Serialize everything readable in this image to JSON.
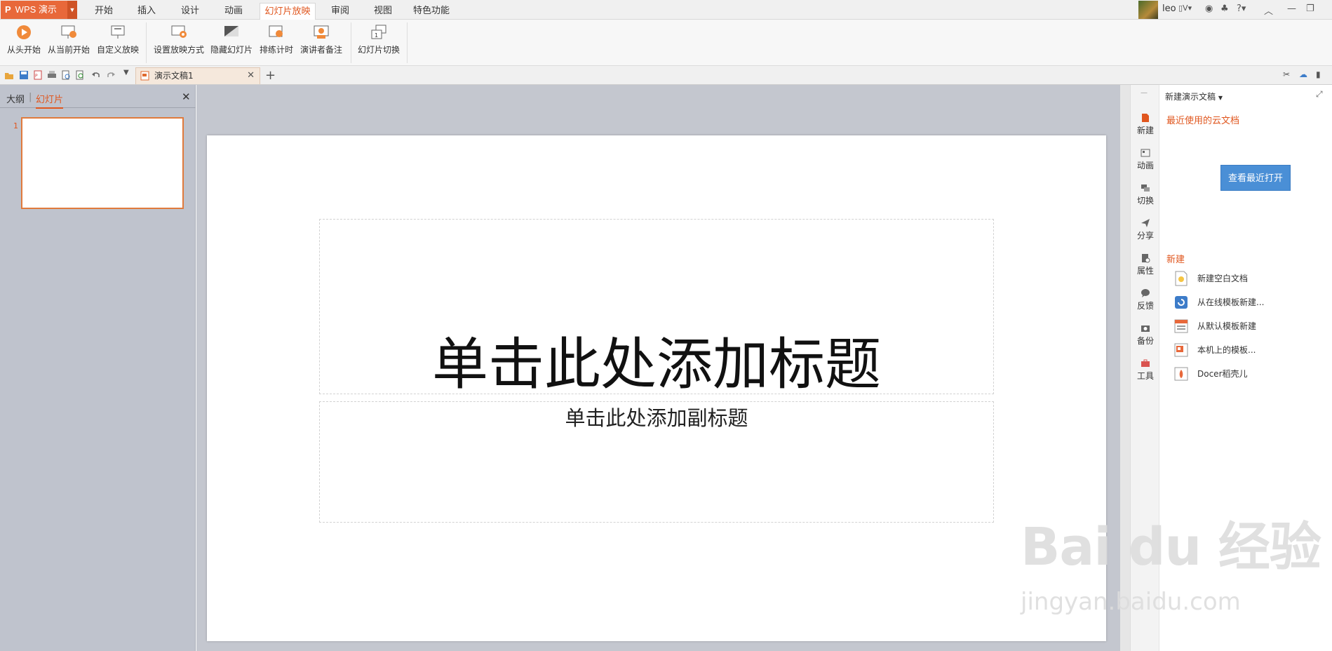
{
  "app": {
    "logo_text": "WPS 演示",
    "logo_glyph": "P"
  },
  "menu": {
    "tabs": [
      "开始",
      "插入",
      "设计",
      "动画",
      "幻灯片放映",
      "审阅",
      "视图",
      "特色功能"
    ],
    "active_tab": "幻灯片放映"
  },
  "account": {
    "user_name": "leo"
  },
  "ribbon": {
    "buttons": [
      "从头开始",
      "从当前开始",
      "自定义放映",
      "设置放映方式",
      "隐藏幻灯片",
      "排练计时",
      "演讲者备注",
      "幻灯片切换"
    ]
  },
  "document": {
    "tab_title": "演示文稿1",
    "add_tab": "+"
  },
  "slide_pane": {
    "tab_outline": "大纲",
    "tab_slides": "幻灯片",
    "slide_number": "1"
  },
  "slide": {
    "title_placeholder": "单击此处添加标题",
    "subtitle_placeholder": "单击此处添加副标题"
  },
  "side_strip": {
    "items": [
      "新建",
      "动画",
      "切换",
      "分享",
      "属性",
      "反馈",
      "备份",
      "工具"
    ]
  },
  "right_panel": {
    "header": "新建演示文稿",
    "cloud_section": "最近使用的云文档",
    "recent_button": "查看最近打开",
    "new_section": "新建",
    "new_items": [
      "新建空白文档",
      "从在线模板新建...",
      "从默认模板新建",
      "本机上的模板...",
      "Docer稻壳儿"
    ]
  },
  "watermark": {
    "main": "Bai du 经验",
    "sub": "jingyan.baidu.com"
  },
  "colors": {
    "accent": "#e0561e",
    "logo": "#e8683a",
    "button_blue": "#4a8fd6",
    "pane_bg": "#bfc3cd"
  }
}
